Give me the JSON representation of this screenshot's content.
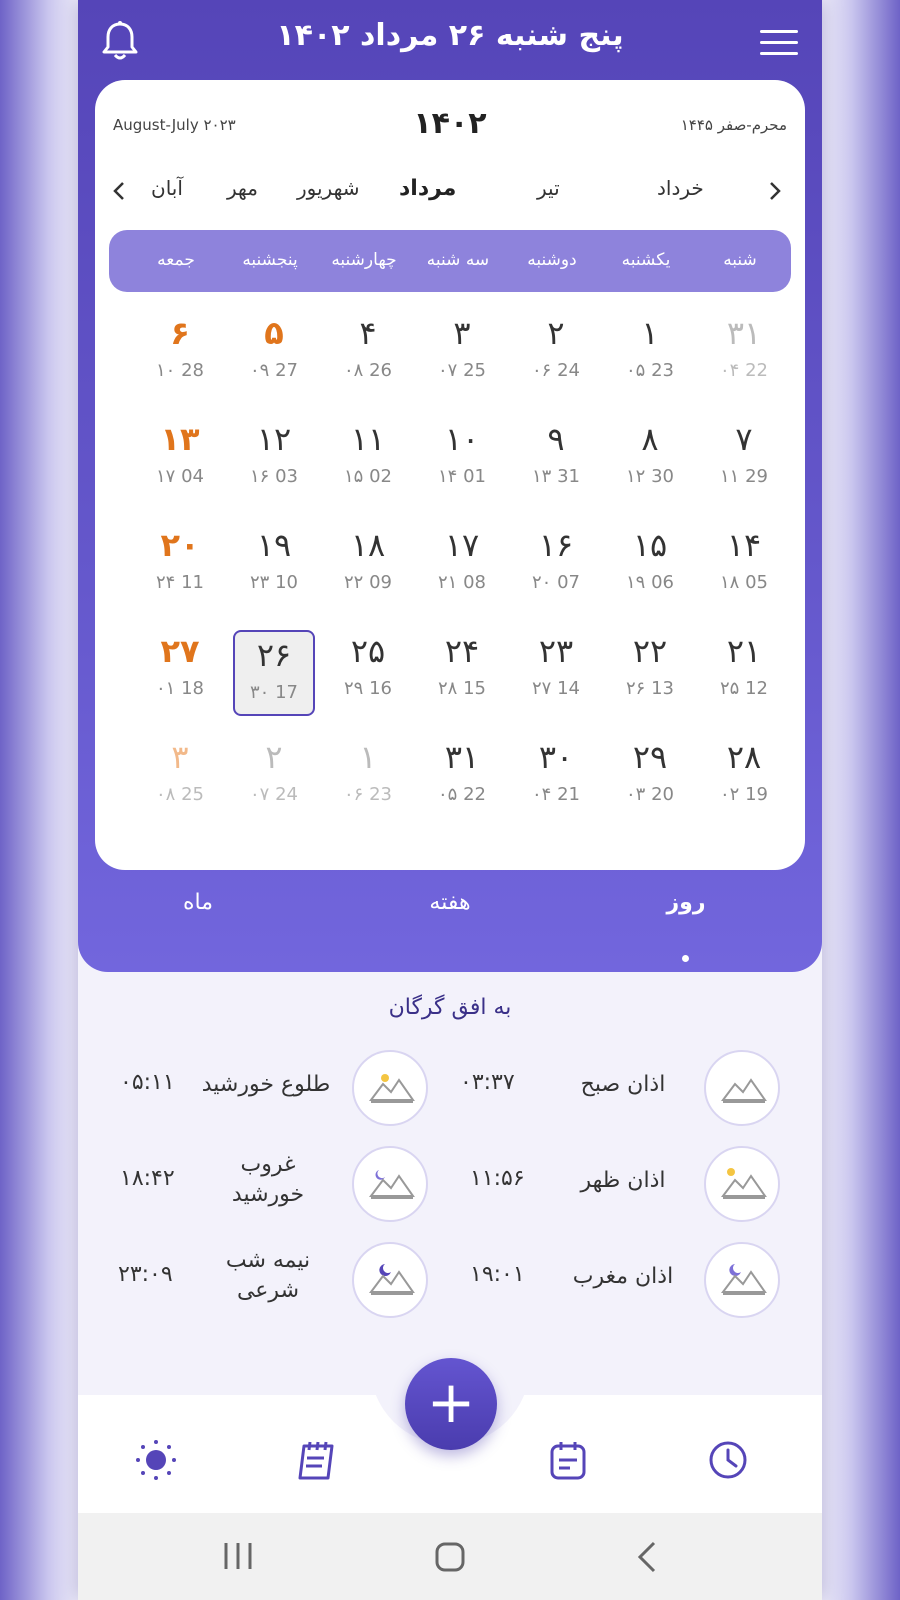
{
  "header": {
    "title": "پنج شنبه ۲۶ مرداد ۱۴۰۲"
  },
  "calendar": {
    "year": "۱۴۰۲",
    "gregorian_range": "August-July ۲۰۲۳",
    "hijri_range": "محرم-صفر ۱۴۴۵",
    "months": [
      "خرداد",
      "تیر",
      "مرداد",
      "شهریور",
      "مهر",
      "آبان"
    ],
    "active_month": "مرداد",
    "weekdays": [
      "شنبه",
      "یکشنبه",
      "دوشنبه",
      "سه شنبه",
      "چهارشنبه",
      "پنجشنبه",
      "جمعه"
    ],
    "weeks": [
      [
        {
          "p": "۳۱",
          "s": "۰۴ 22",
          "out": true
        },
        {
          "p": "۱",
          "s": "۰۵ 23"
        },
        {
          "p": "۲",
          "s": "۰۶ 24"
        },
        {
          "p": "۳",
          "s": "۰۷ 25"
        },
        {
          "p": "۴",
          "s": "۰۸ 26"
        },
        {
          "p": "۵",
          "s": "۰۹ 27",
          "fri": true
        },
        {
          "p": "۶",
          "s": "۱۰ 28",
          "fri": true
        }
      ],
      [
        {
          "p": "۷",
          "s": "۱۱ 29"
        },
        {
          "p": "۸",
          "s": "۱۲ 30"
        },
        {
          "p": "۹",
          "s": "۱۳ 31"
        },
        {
          "p": "۱۰",
          "s": "۱۴ 01"
        },
        {
          "p": "۱۱",
          "s": "۱۵ 02"
        },
        {
          "p": "۱۲",
          "s": "۱۶ 03"
        },
        {
          "p": "۱۳",
          "s": "۱۷ 04",
          "fri": true
        }
      ],
      [
        {
          "p": "۱۴",
          "s": "۱۸ 05"
        },
        {
          "p": "۱۵",
          "s": "۱۹ 06"
        },
        {
          "p": "۱۶",
          "s": "۲۰ 07"
        },
        {
          "p": "۱۷",
          "s": "۲۱ 08"
        },
        {
          "p": "۱۸",
          "s": "۲۲ 09"
        },
        {
          "p": "۱۹",
          "s": "۲۳ 10"
        },
        {
          "p": "۲۰",
          "s": "۲۴ 11",
          "fri": true
        }
      ],
      [
        {
          "p": "۲۱",
          "s": "۲۵ 12"
        },
        {
          "p": "۲۲",
          "s": "۲۶ 13"
        },
        {
          "p": "۲۳",
          "s": "۲۷ 14"
        },
        {
          "p": "۲۴",
          "s": "۲۸ 15"
        },
        {
          "p": "۲۵",
          "s": "۲۹ 16"
        },
        {
          "p": "۲۶",
          "s": "۳۰ 17",
          "today": true
        },
        {
          "p": "۲۷",
          "s": "۰۱ 18",
          "fri": true
        }
      ],
      [
        {
          "p": "۲۸",
          "s": "۰۲ 19"
        },
        {
          "p": "۲۹",
          "s": "۰۳ 20"
        },
        {
          "p": "۳۰",
          "s": "۰۴ 21"
        },
        {
          "p": "۳۱",
          "s": "۰۵ 22"
        },
        {
          "p": "۱",
          "s": "۰۶ 23",
          "out": true
        },
        {
          "p": "۲",
          "s": "۰۷ 24",
          "out": true
        },
        {
          "p": "۳",
          "s": "۰۸ 25",
          "out": true,
          "fri": true
        }
      ]
    ]
  },
  "tabs": {
    "day": "روز",
    "week": "هفته",
    "month": "ماه",
    "active": "day"
  },
  "prayer": {
    "horizon": "به افق گرگان",
    "times": {
      "fajr": {
        "name": "اذان صبح",
        "time": "۰۳:۳۷"
      },
      "sunrise": {
        "name": "طلوع خورشید",
        "time": "۰۵:۱۱"
      },
      "dhuhr": {
        "name": "اذان ظهر",
        "time": "۱۱:۵۶"
      },
      "sunset": {
        "name": "غروب خورشید",
        "time": "۱۸:۴۲"
      },
      "maghrib": {
        "name": "اذان مغرب",
        "time": "۱۹:۰۱"
      },
      "midnight": {
        "name": "نیمه شب شرعی",
        "time": "۲۳:۰۹"
      }
    }
  },
  "fab": {
    "label": "+"
  },
  "colors": {
    "primary": "#5545b8",
    "friday": "#e0751c",
    "weekbar": "#8e83dc"
  }
}
